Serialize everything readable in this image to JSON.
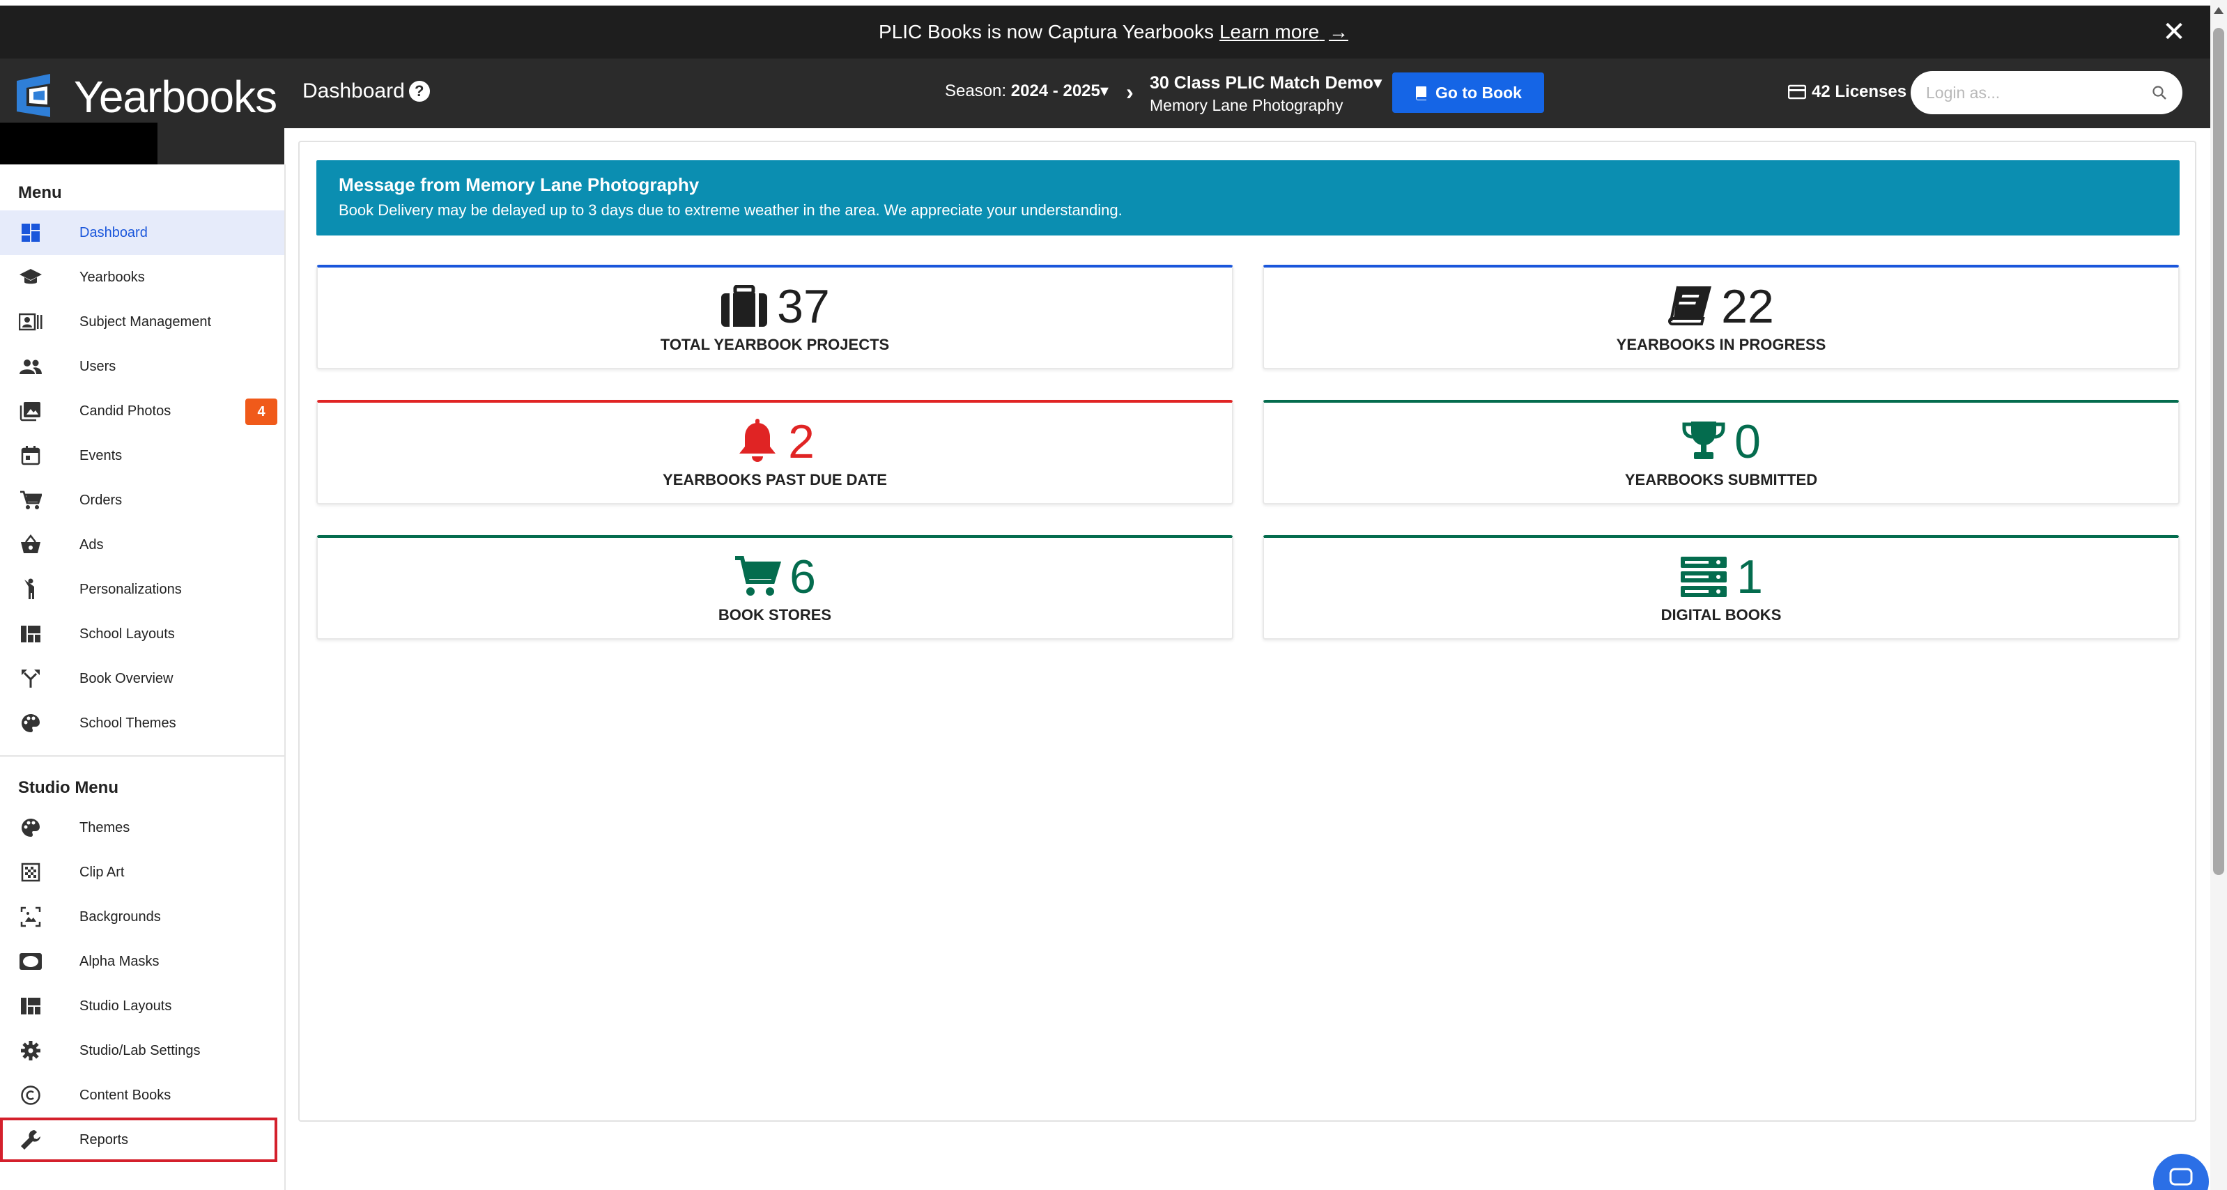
{
  "announcement": {
    "text": "PLIC Books is now Captura Yearbooks",
    "link_label": "Learn more",
    "link_arrow": "→",
    "close_label": "✕"
  },
  "logo": {
    "name": "Yearbooks"
  },
  "header": {
    "page_title": "Dashboard",
    "help_label": "?",
    "season_label": "Season:",
    "season_value": "2024 - 2025",
    "season_caret": "▾",
    "breadcrumb_sep": "›",
    "book_title": "30 Class PLIC Match Demo",
    "book_caret": "▾",
    "studio_name": "Memory Lane Photography",
    "go_to_book_label": "Go to Book",
    "licenses_label": "42 Licenses",
    "login_placeholder": "Login as..."
  },
  "sidebar": {
    "menu_title": "Menu",
    "menu_items": [
      {
        "label": "Dashboard",
        "icon": "dashboard-icon"
      },
      {
        "label": "Yearbooks",
        "icon": "graduation-cap-icon"
      },
      {
        "label": "Subject Management",
        "icon": "contact-card-icon"
      },
      {
        "label": "Users",
        "icon": "people-icon"
      },
      {
        "label": "Candid Photos",
        "icon": "photo-library-icon",
        "badge": "4"
      },
      {
        "label": "Events",
        "icon": "calendar-icon"
      },
      {
        "label": "Orders",
        "icon": "cart-icon"
      },
      {
        "label": "Ads",
        "icon": "basket-icon"
      },
      {
        "label": "Personalizations",
        "icon": "person-cheer-icon"
      },
      {
        "label": "School Layouts",
        "icon": "layout-icon"
      },
      {
        "label": "Book Overview",
        "icon": "fork-icon"
      },
      {
        "label": "School Themes",
        "icon": "palette-icon"
      }
    ],
    "studio_title": "Studio Menu",
    "studio_items": [
      {
        "label": "Themes",
        "icon": "palette-icon"
      },
      {
        "label": "Clip Art",
        "icon": "grid-pattern-icon"
      },
      {
        "label": "Backgrounds",
        "icon": "image-frame-icon"
      },
      {
        "label": "Alpha Masks",
        "icon": "oval-mask-icon"
      },
      {
        "label": "Studio Layouts",
        "icon": "layout-icon"
      },
      {
        "label": "Studio/Lab Settings",
        "icon": "gear-icon"
      },
      {
        "label": "Content Books",
        "icon": "copyright-icon"
      },
      {
        "label": "Reports",
        "icon": "wrench-icon"
      }
    ]
  },
  "alert": {
    "title": "Message from Memory Lane Photography",
    "body": "Book Delivery may be delayed up to 3 days due to extreme weather in the area. We appreciate your understanding."
  },
  "stats": [
    {
      "value": "37",
      "label": "TOTAL YEARBOOK PROJECTS",
      "icon": "briefcase-icon",
      "color": "#1f1f1f",
      "accent": "#1a56db"
    },
    {
      "value": "22",
      "label": "YEARBOOKS IN PROGRESS",
      "icon": "book-icon",
      "color": "#1f1f1f",
      "accent": "#1a56db"
    },
    {
      "value": "2",
      "label": "YEARBOOKS PAST DUE DATE",
      "icon": "bell-icon",
      "color": "#e02424",
      "accent": "#e02424"
    },
    {
      "value": "0",
      "label": "YEARBOOKS SUBMITTED",
      "icon": "trophy-icon",
      "color": "#046c4e",
      "accent": "#046c4e"
    },
    {
      "value": "6",
      "label": "BOOK STORES",
      "icon": "cart-icon",
      "color": "#046c4e",
      "accent": "#046c4e"
    },
    {
      "value": "1",
      "label": "DIGITAL BOOKS",
      "icon": "server-stack-icon",
      "color": "#046c4e",
      "accent": "#046c4e"
    }
  ]
}
